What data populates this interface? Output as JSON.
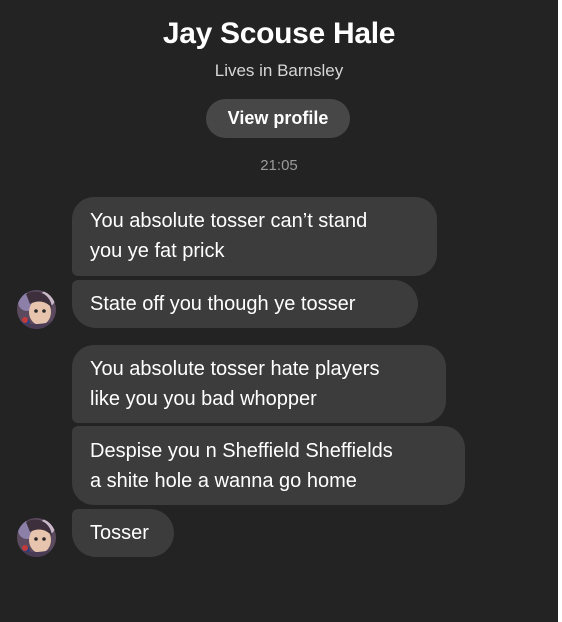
{
  "contact": {
    "name": "Jay Scouse Hale",
    "location": "Lives in Barnsley",
    "view_profile_label": "View profile"
  },
  "timestamp": "21:05",
  "messages": [
    {
      "lines": [
        "You absolute tosser can’t stand",
        "you ye fat prick"
      ]
    },
    {
      "lines": [
        "State off you though ye tosser"
      ]
    },
    {
      "lines": [
        "You absolute tosser hate players",
        "like you you bad whopper"
      ]
    },
    {
      "lines": [
        "Despise you n Sheffield Sheffields",
        "a shite hole a wanna go home"
      ]
    },
    {
      "lines": [
        "Tosser"
      ]
    }
  ],
  "colors": {
    "background": "#232323",
    "bubble": "#3c3c3c",
    "button": "#474747",
    "text": "#ffffff",
    "subtext": "#d6d6d6",
    "timestamp": "#9a9a9a"
  },
  "icons": {
    "avatar": "profile-photo-avatar"
  }
}
